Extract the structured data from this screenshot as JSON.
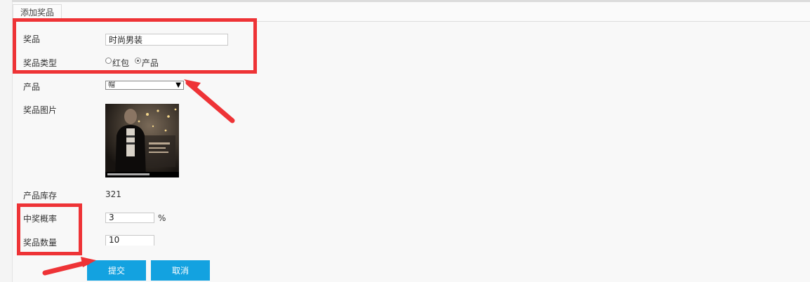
{
  "tab": {
    "label": "添加奖品"
  },
  "form": {
    "prize_label": "奖品",
    "prize_value": "时尚男装",
    "type_label": "奖品类型",
    "type_options": [
      "红包",
      "产品"
    ],
    "type_selected": "产品",
    "product_label": "产品",
    "product_selected": "帽",
    "image_label": "奖品图片",
    "image_name": "prize-photo",
    "stock_label": "产品库存",
    "stock_value": "321",
    "prob_label": "中奖概率",
    "prob_value": "3",
    "prob_unit": "%",
    "qty_label": "奖品数量",
    "qty_value": "10"
  },
  "buttons": {
    "submit": "提交",
    "cancel": "取消"
  },
  "colors": {
    "primary_button": "#13a2e0",
    "annotation": "#ee3336"
  }
}
